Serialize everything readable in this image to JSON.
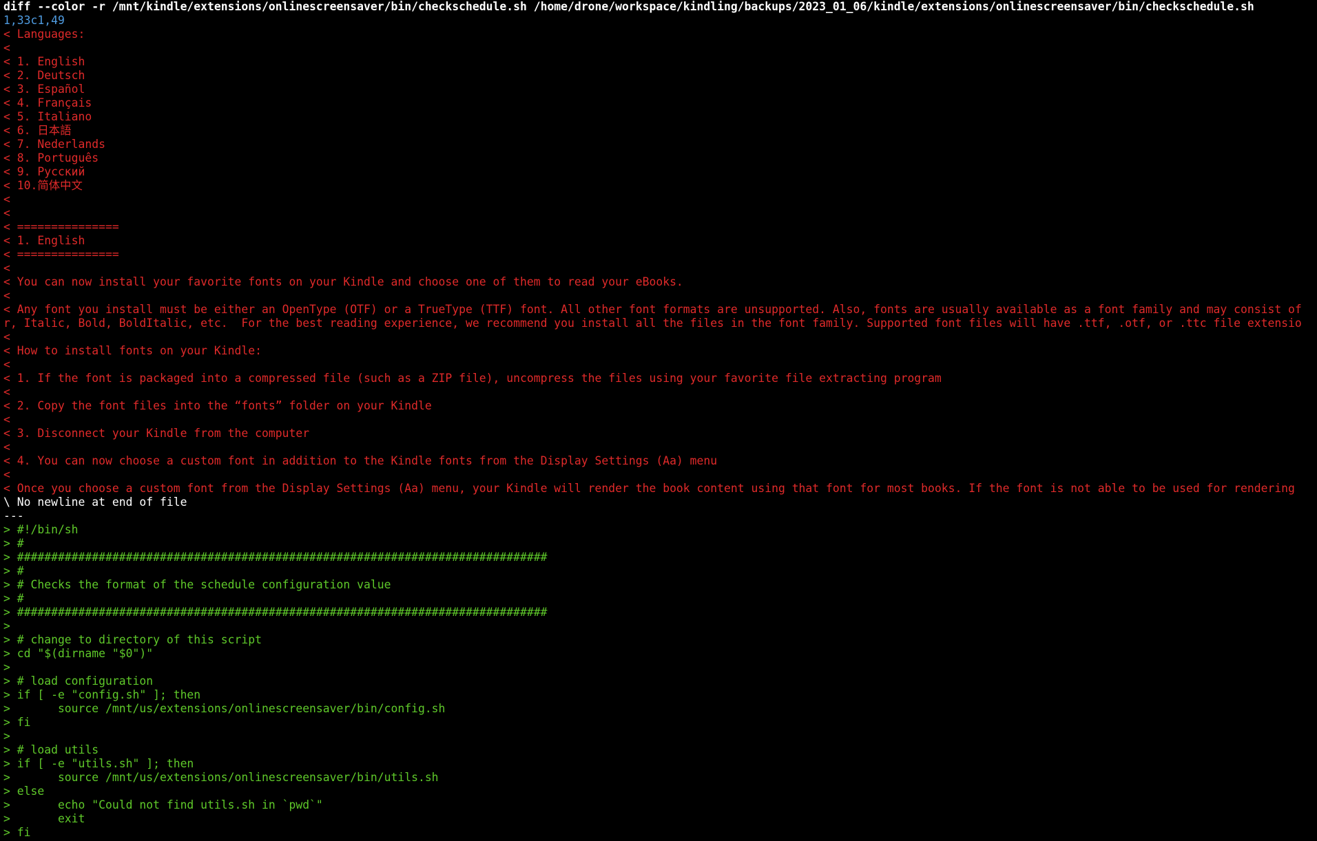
{
  "colors": {
    "background": "#000000",
    "header": "#ffffff",
    "hunk": "#4f9be0",
    "removed": "#e02a2a",
    "added": "#5fc92a",
    "plain": "#ffffff"
  },
  "terminal": {
    "lines": [
      {
        "type": "header",
        "text": "diff --color -r /mnt/kindle/extensions/onlinescreensaver/bin/checkschedule.sh /home/drone/workspace/kindling/backups/2023_01_06/kindle/extensions/onlinescreensaver/bin/checkschedule.sh"
      },
      {
        "type": "hunk",
        "text": "1,33c1,49"
      },
      {
        "type": "removed",
        "text": "< Languages:"
      },
      {
        "type": "removed",
        "text": "<"
      },
      {
        "type": "removed",
        "text": "< 1. English"
      },
      {
        "type": "removed",
        "text": "< 2. Deutsch"
      },
      {
        "type": "removed",
        "text": "< 3. Español"
      },
      {
        "type": "removed",
        "text": "< 4. Français"
      },
      {
        "type": "removed",
        "text": "< 5. Italiano"
      },
      {
        "type": "removed",
        "text": "< 6. 日本語"
      },
      {
        "type": "removed",
        "text": "< 7. Nederlands"
      },
      {
        "type": "removed",
        "text": "< 8. Português"
      },
      {
        "type": "removed",
        "text": "< 9. Русский"
      },
      {
        "type": "removed",
        "text": "< 10.简体中文"
      },
      {
        "type": "removed",
        "text": "<"
      },
      {
        "type": "removed",
        "text": "<"
      },
      {
        "type": "removed",
        "text": "< ==============="
      },
      {
        "type": "removed",
        "text": "< 1. English"
      },
      {
        "type": "removed",
        "text": "< ==============="
      },
      {
        "type": "removed",
        "text": "<"
      },
      {
        "type": "removed",
        "text": "< You can now install your favorite fonts on your Kindle and choose one of them to read your eBooks."
      },
      {
        "type": "removed",
        "text": "<"
      },
      {
        "type": "removed",
        "text": "< Any font you install must be either an OpenType (OTF) or a TrueType (TTF) font. All other font formats are unsupported. Also, fonts are usually available as a font family and may consist of"
      },
      {
        "type": "removed",
        "text": "r, Italic, Bold, BoldItalic, etc.  For the best reading experience, we recommend you install all the files in the font family. Supported font files will have .ttf, .otf, or .ttc file extensio"
      },
      {
        "type": "removed",
        "text": "<"
      },
      {
        "type": "removed",
        "text": "< How to install fonts on your Kindle:"
      },
      {
        "type": "removed",
        "text": "<"
      },
      {
        "type": "removed",
        "text": "< 1. If the font is packaged into a compressed file (such as a ZIP file), uncompress the files using your favorite file extracting program"
      },
      {
        "type": "removed",
        "text": "<"
      },
      {
        "type": "removed",
        "text": "< 2. Copy the font files into the “fonts” folder on your Kindle"
      },
      {
        "type": "removed",
        "text": "<"
      },
      {
        "type": "removed",
        "text": "< 3. Disconnect your Kindle from the computer"
      },
      {
        "type": "removed",
        "text": "<"
      },
      {
        "type": "removed",
        "text": "< 4. You can now choose a custom font in addition to the Kindle fonts from the Display Settings (Aa) menu"
      },
      {
        "type": "removed",
        "text": "<"
      },
      {
        "type": "removed",
        "text": "< Once you choose a custom font from the Display Settings (Aa) menu, your Kindle will render the book content using that font for most books. If the font is not able to be used for rendering"
      },
      {
        "type": "plain",
        "text": "\\ No newline at end of file"
      },
      {
        "type": "plain",
        "text": "---"
      },
      {
        "type": "added",
        "text": "> #!/bin/sh"
      },
      {
        "type": "added",
        "text": "> #"
      },
      {
        "type": "added",
        "text": "> ##############################################################################"
      },
      {
        "type": "added",
        "text": "> #"
      },
      {
        "type": "added",
        "text": "> # Checks the format of the schedule configuration value"
      },
      {
        "type": "added",
        "text": "> #"
      },
      {
        "type": "added",
        "text": "> ##############################################################################"
      },
      {
        "type": "added",
        "text": ">"
      },
      {
        "type": "added",
        "text": "> # change to directory of this script"
      },
      {
        "type": "added",
        "text": "> cd \"$(dirname \"$0\")\""
      },
      {
        "type": "added",
        "text": ">"
      },
      {
        "type": "added",
        "text": "> # load configuration"
      },
      {
        "type": "added",
        "text": "> if [ -e \"config.sh\" ]; then"
      },
      {
        "type": "added",
        "text": ">       source /mnt/us/extensions/onlinescreensaver/bin/config.sh"
      },
      {
        "type": "added",
        "text": "> fi"
      },
      {
        "type": "added",
        "text": ">"
      },
      {
        "type": "added",
        "text": "> # load utils"
      },
      {
        "type": "added",
        "text": "> if [ -e \"utils.sh\" ]; then"
      },
      {
        "type": "added",
        "text": ">       source /mnt/us/extensions/onlinescreensaver/bin/utils.sh"
      },
      {
        "type": "added",
        "text": "> else"
      },
      {
        "type": "added",
        "text": ">       echo \"Could not find utils.sh in `pwd`\""
      },
      {
        "type": "added",
        "text": ">       exit"
      },
      {
        "type": "added",
        "text": "> fi"
      }
    ]
  }
}
